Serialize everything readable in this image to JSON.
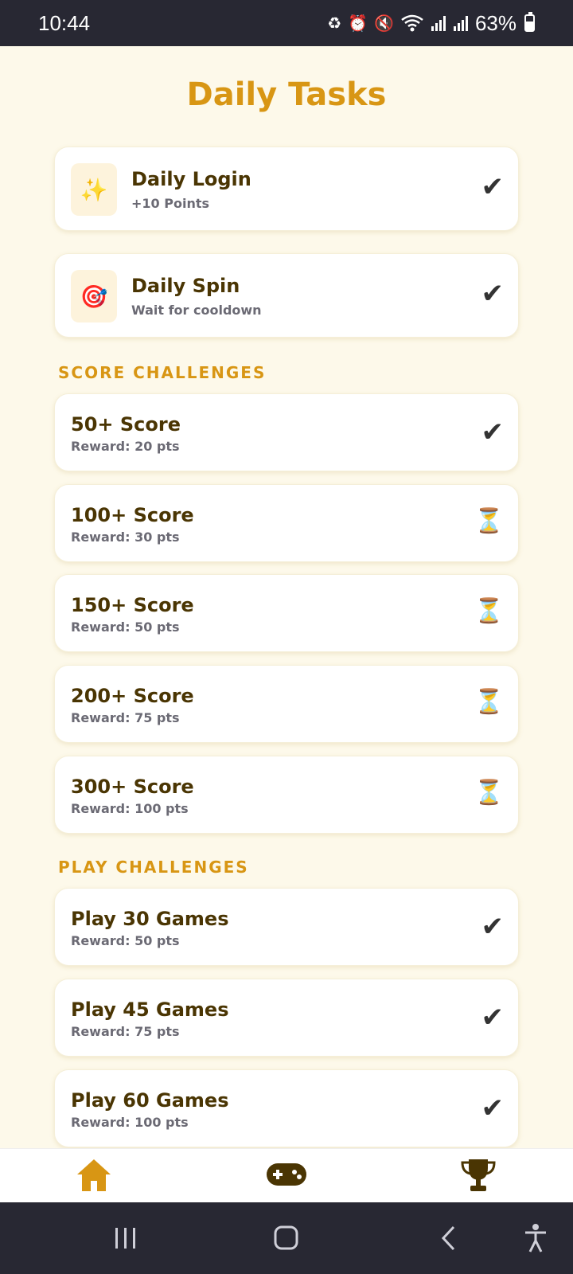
{
  "status_bar": {
    "time": "10:44",
    "battery": "63%",
    "battery_level": 0.63,
    "icons": [
      "battery-saver-icon",
      "alarm-icon",
      "mute-icon",
      "wifi-icon",
      "signal-icon",
      "signal-icon"
    ]
  },
  "page_title": "Daily Tasks",
  "daily": [
    {
      "icon": "sparkles-icon",
      "icon_glyph": "✨",
      "title": "Daily Login",
      "sub": "+10 Points",
      "status": "done"
    },
    {
      "icon": "target-icon",
      "icon_glyph": "🎯",
      "title": "Daily Spin",
      "sub": "Wait for cooldown",
      "status": "done"
    }
  ],
  "score_section": {
    "label": "SCORE CHALLENGES",
    "items": [
      {
        "title": "50+ Score",
        "sub": "Reward: 20 pts",
        "status": "done"
      },
      {
        "title": "100+ Score",
        "sub": "Reward: 30 pts",
        "status": "pending"
      },
      {
        "title": "150+ Score",
        "sub": "Reward: 50 pts",
        "status": "pending"
      },
      {
        "title": "200+ Score",
        "sub": "Reward: 75 pts",
        "status": "pending"
      },
      {
        "title": "300+ Score",
        "sub": "Reward: 100 pts",
        "status": "pending"
      }
    ]
  },
  "play_section": {
    "label": "PLAY CHALLENGES",
    "items": [
      {
        "title": "Play 30 Games",
        "sub": "Reward: 50 pts",
        "status": "done"
      },
      {
        "title": "Play 45 Games",
        "sub": "Reward: 75 pts",
        "status": "done"
      },
      {
        "title": "Play 60 Games",
        "sub": "Reward: 100 pts",
        "status": "done"
      }
    ]
  },
  "status_glyphs": {
    "done": "✔",
    "pending": "⏳"
  },
  "bottom_nav": [
    {
      "name": "home-icon",
      "active": true
    },
    {
      "name": "gamepad-icon",
      "active": false
    },
    {
      "name": "trophy-icon",
      "active": false
    }
  ],
  "colors": {
    "accent": "#d89614",
    "title_text": "#4a3503",
    "sub_text": "#6b6a74",
    "background": "#fdf9ea",
    "nav_dark": "#4a3503"
  }
}
